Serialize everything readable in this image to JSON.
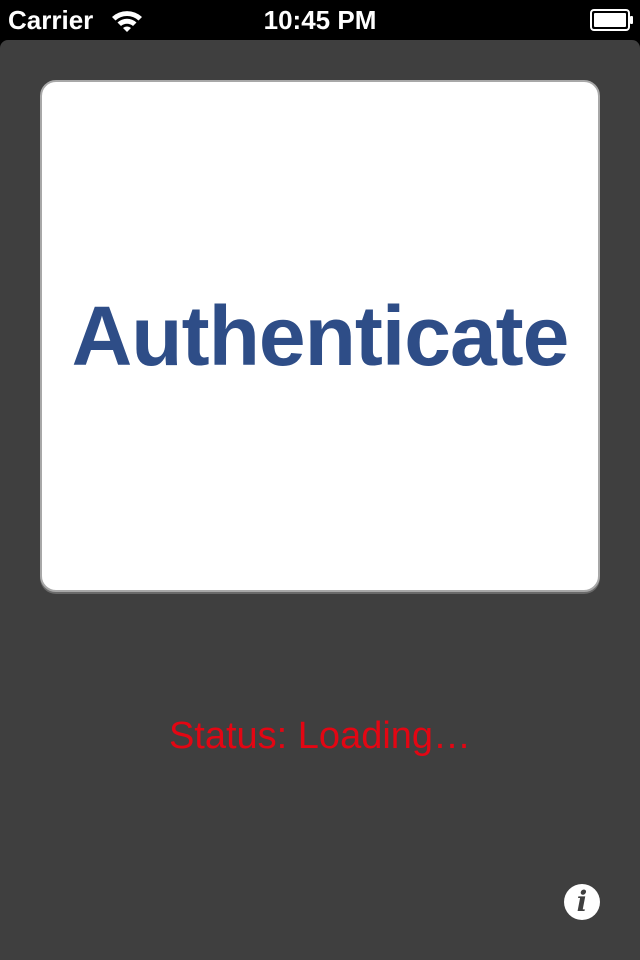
{
  "status_bar": {
    "carrier": "Carrier",
    "time": "10:45 PM",
    "wifi_icon": "wifi-icon",
    "battery_icon": "battery-icon"
  },
  "main": {
    "authenticate_label": "Authenticate",
    "status_text": "Status: Loading…",
    "info_icon": "info-icon",
    "info_glyph": "i"
  },
  "colors": {
    "background": "#3f3f3f",
    "button_text": "#2e4d87",
    "status_text": "#e30613",
    "status_bar": "#000000"
  }
}
